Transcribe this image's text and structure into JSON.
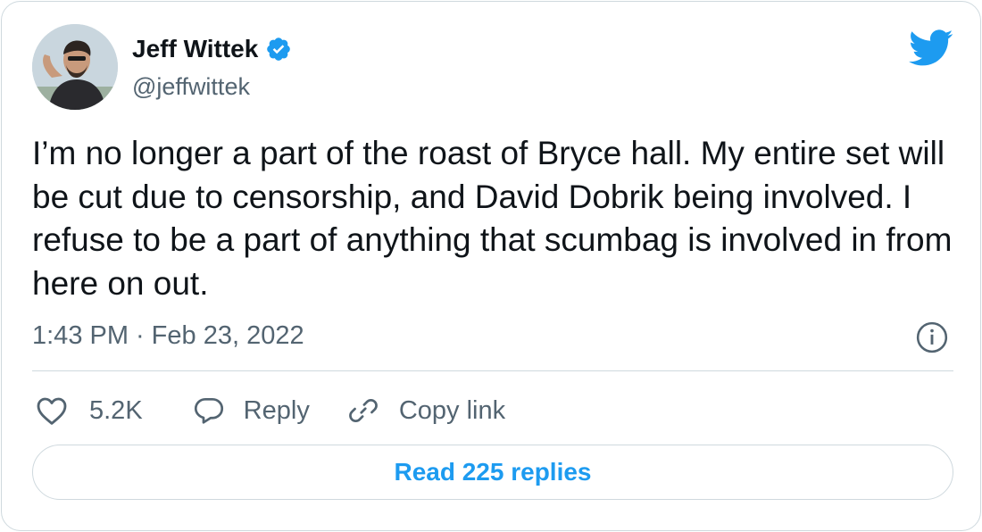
{
  "author": {
    "name": "Jeff Wittek",
    "handle": "@jeffwittek",
    "verified_icon": "verified-badge-icon",
    "avatar_icon": "avatar-photo"
  },
  "brand": {
    "icon": "twitter-bird-icon",
    "color": "#1d9bf0"
  },
  "tweet": {
    "text": "I’m no longer a part of the roast of Bryce hall. My entire set will be cut due to censorship, and David Dobrik being involved. I refuse to be a part of anything that scumbag is involved in from here on out.",
    "time": "1:43 PM",
    "separator": "·",
    "date": "Feb 23, 2022",
    "info_icon": "info-icon"
  },
  "actions": {
    "like": {
      "icon": "heart-icon",
      "count": "5.2K"
    },
    "reply": {
      "icon": "reply-bubble-icon",
      "label": "Reply"
    },
    "copy": {
      "icon": "link-icon",
      "label": "Copy link"
    }
  },
  "read_replies": {
    "label": "Read 225 replies"
  },
  "colors": {
    "text": "#0f1419",
    "secondary": "#536471",
    "border": "#cfd9de",
    "accent": "#1d9bf0"
  }
}
